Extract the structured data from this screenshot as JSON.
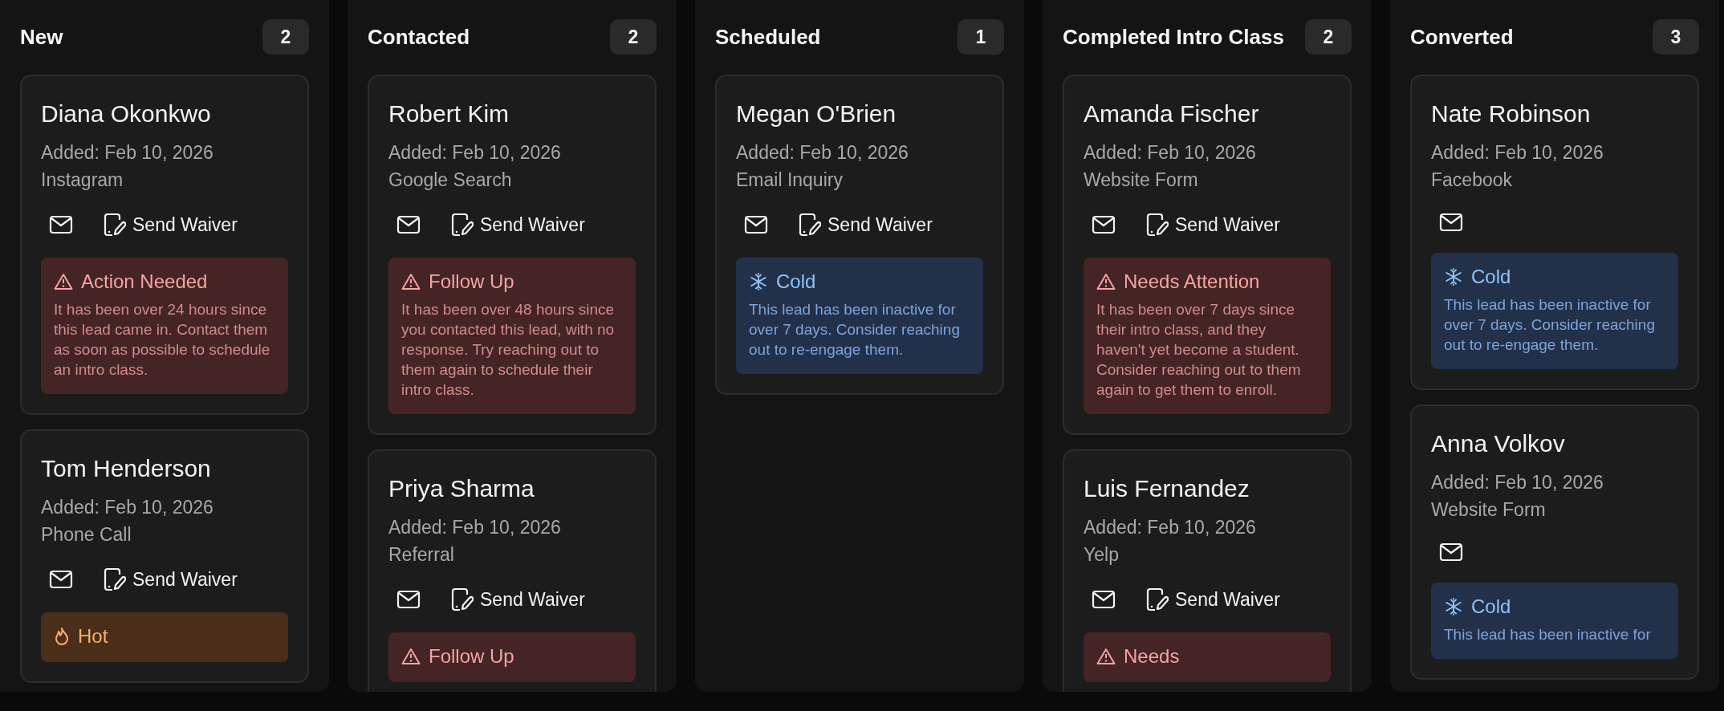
{
  "columns": [
    {
      "title": "New",
      "count": "2",
      "cards": [
        {
          "name": "Diana Okonkwo",
          "added": "Added: Feb 10, 2026",
          "source": "Instagram",
          "actions": [
            {
              "kind": "email"
            },
            {
              "kind": "waiver",
              "label": "Send Waiver"
            }
          ],
          "alert": {
            "kind": "warning",
            "title": "Action Needed",
            "body": "It has been over 24 hours since this lead came in. Contact them as soon as possible to schedule an intro class."
          }
        },
        {
          "name": "Tom Henderson",
          "added": "Added: Feb 10, 2026",
          "source": "Phone Call",
          "actions": [
            {
              "kind": "email"
            },
            {
              "kind": "waiver",
              "label": "Send Waiver"
            }
          ],
          "alert": {
            "kind": "hot",
            "title": "Hot"
          }
        }
      ]
    },
    {
      "title": "Contacted",
      "count": "2",
      "cards": [
        {
          "name": "Robert Kim",
          "added": "Added: Feb 10, 2026",
          "source": "Google Search",
          "actions": [
            {
              "kind": "email"
            },
            {
              "kind": "waiver",
              "label": "Send Waiver"
            }
          ],
          "alert": {
            "kind": "warning",
            "title": "Follow Up",
            "body": "It has been over 48 hours since you contacted this lead, with no response. Try reaching out to them again to schedule their intro class."
          }
        },
        {
          "name": "Priya Sharma",
          "added": "Added: Feb 10, 2026",
          "source": "Referral",
          "actions": [
            {
              "kind": "email"
            },
            {
              "kind": "waiver",
              "label": "Send Waiver"
            }
          ],
          "alert": {
            "kind": "warning",
            "title": "Follow Up"
          }
        }
      ]
    },
    {
      "title": "Scheduled",
      "count": "1",
      "cards": [
        {
          "name": "Megan O'Brien",
          "added": "Added: Feb 10, 2026",
          "source": "Email Inquiry",
          "actions": [
            {
              "kind": "email"
            },
            {
              "kind": "waiver",
              "label": "Send Waiver"
            }
          ],
          "alert": {
            "kind": "cold",
            "title": "Cold",
            "body": "This lead has been inactive for over 7 days. Consider reaching out to re-engage them."
          }
        }
      ]
    },
    {
      "title": "Completed Intro Class",
      "count": "2",
      "cards": [
        {
          "name": "Amanda Fischer",
          "added": "Added: Feb 10, 2026",
          "source": "Website Form",
          "actions": [
            {
              "kind": "email"
            },
            {
              "kind": "waiver",
              "label": "Send Waiver"
            }
          ],
          "alert": {
            "kind": "warning",
            "title": "Needs Attention",
            "body": "It has been over 7 days since their intro class, and they haven't yet become a student. Consider reaching out to them again to get them to enroll."
          }
        },
        {
          "name": "Luis Fernandez",
          "added": "Added: Feb 10, 2026",
          "source": "Yelp",
          "actions": [
            {
              "kind": "email"
            },
            {
              "kind": "waiver",
              "label": "Send Waiver"
            }
          ],
          "alert": {
            "kind": "warning",
            "title": "Needs"
          }
        }
      ]
    },
    {
      "title": "Converted",
      "count": "3",
      "cards": [
        {
          "name": "Nate Robinson",
          "added": "Added: Feb 10, 2026",
          "source": "Facebook",
          "actions": [
            {
              "kind": "email"
            }
          ],
          "alert": {
            "kind": "cold",
            "title": "Cold",
            "body": "This lead has been inactive for over 7 days. Consider reaching out to re-engage them."
          }
        },
        {
          "name": "Anna Volkov",
          "added": "Added: Feb 10, 2026",
          "source": "Website Form",
          "actions": [
            {
              "kind": "email"
            }
          ],
          "alert": {
            "kind": "cold",
            "title": "Cold",
            "body": "This lead has been inactive for"
          }
        }
      ]
    }
  ]
}
